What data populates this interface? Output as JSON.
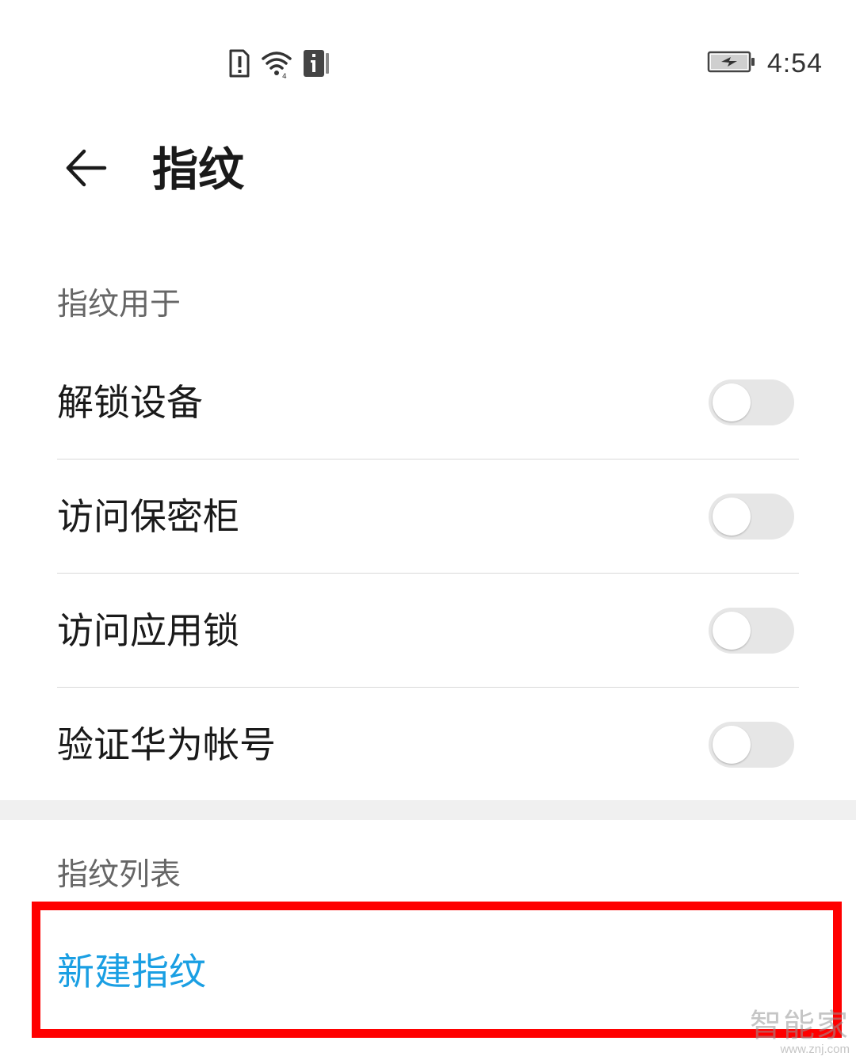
{
  "status_bar": {
    "time": "4:54",
    "icons": [
      "sim-alert-icon",
      "wifi-icon",
      "notification-info-icon",
      "battery-charging-icon"
    ]
  },
  "title_bar": {
    "back_icon": "arrow-left-icon",
    "title": "指纹"
  },
  "usage_section": {
    "header": "指纹用于",
    "items": [
      {
        "label": "解锁设备",
        "enabled": false
      },
      {
        "label": "访问保密柜",
        "enabled": false
      },
      {
        "label": "访问应用锁",
        "enabled": false
      },
      {
        "label": "验证华为帐号",
        "enabled": false
      }
    ]
  },
  "fingerprint_list": {
    "header": "指纹列表",
    "new_label": "新建指纹"
  },
  "colors": {
    "accent": "#1a9fe3",
    "highlight": "#ff0000",
    "switch_off": "#e6e6e6"
  },
  "watermark": {
    "cn": "智能家",
    "url": "www.znj.com"
  }
}
